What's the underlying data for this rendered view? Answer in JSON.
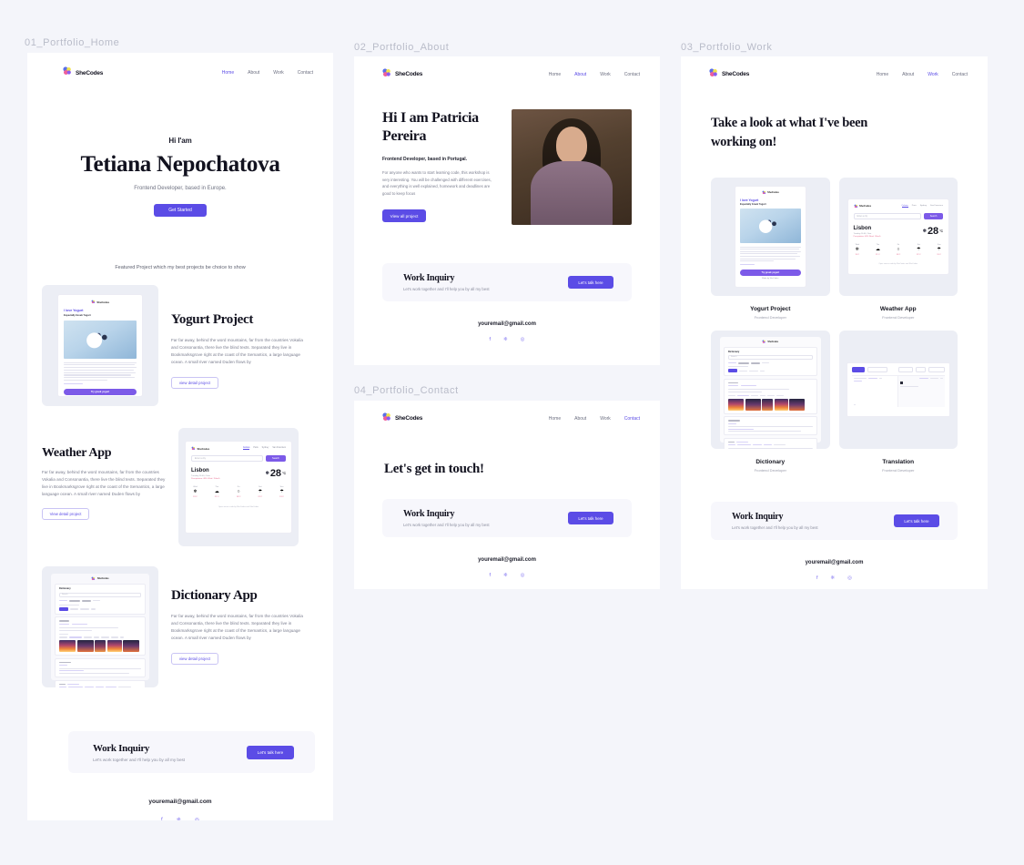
{
  "canvas": {
    "background": "#f4f5fa",
    "accent": "#5b4ce6",
    "ink": "#12121f",
    "muted": "#7b7e8f"
  },
  "brand": {
    "name": "SheCodes"
  },
  "frames": [
    {
      "id": "f1",
      "label": "01_Portfolio_Home"
    },
    {
      "id": "f2",
      "label": "02_Portfolio_About"
    },
    {
      "id": "f3",
      "label": "03_Portfolio_Work"
    },
    {
      "id": "f4",
      "label": "04_Portfolio_Contact"
    }
  ],
  "nav": {
    "items": [
      "Home",
      "About",
      "Work",
      "Contact"
    ],
    "active_home": "Home",
    "active_about": "About",
    "active_work": "Work",
    "active_contact": "Contact"
  },
  "home": {
    "eyebrow": "Hi I'am",
    "name": "Tetiana Nepochatova",
    "tagline": "Frontend Developer, based in Europe.",
    "cta": "Get Started",
    "featured_caption": "Featured Project which my best projects be choice to show",
    "projects": [
      {
        "title": "Yogurt Project",
        "body": "Far far away, behind the word mountains, far from the countries Vokalia and Consonantia, there live the blind texts. Separated they live in Bookmarksgrove right at the coast of the Semantics, a large language ocean. A small river named Duden flows by",
        "cta": "view detail project"
      },
      {
        "title": "Weather App",
        "body": "Far far away, behind the word mountains, far from the countries Vokalia and Consonantia, there live the blind texts. Separated they live in Bookmarksgrove right at the coast of the Semantics, a large language ocean. A small river named Duden flows by",
        "cta": "View detail project"
      },
      {
        "title": "Dictionary App",
        "body": "Far far away, behind the word mountains, far from the countries Vokalia and Consonantia, there live the blind texts. Separated they live in Bookmarksgrove right at the coast of the Semantics, a large language ocean. A small river named Duden flows by",
        "cta": "view detail project"
      }
    ]
  },
  "about": {
    "heading": "Hi I am Patricia Pereira",
    "subheading": "Frontend Developer, based in Portugal.",
    "body": "For anyone who wants to start learning code, this workshop is very interesting. You will be challenged with different exercises, and everything is well explained, homework and deadlines are good to keep focus",
    "cta": "View all project"
  },
  "work": {
    "heading": "Take a look at what I've been working on!",
    "cards": [
      {
        "title": "Yogurt Project",
        "role": "Frontend Developer"
      },
      {
        "title": "Weather App",
        "role": "Frontend Developer"
      },
      {
        "title": "Dictionary",
        "role": "Frontend Developer"
      },
      {
        "title": "Translation",
        "role": "Frontend Developer"
      }
    ]
  },
  "contact": {
    "heading": "Let's get in touch!"
  },
  "inquiry": {
    "title": "Work Inquiry",
    "subtitle": "Let's work  together and I'll help you by all my best",
    "cta": "Let's talk here"
  },
  "footer": {
    "email": "youremail@gmail.com",
    "socials": [
      "facebook-icon",
      "twitter-icon",
      "instagram-icon"
    ],
    "glyphs": {
      "facebook": "f",
      "twitter": "❈",
      "instagram": "◎"
    }
  },
  "mockups": {
    "yogurt": {
      "title": "I love Yogurt",
      "subtitle": "Especially Greek Yogurt",
      "cta": "Try greek yogurt",
      "footer": "Made by SheCodes"
    },
    "weather": {
      "search_placeholder": "Enter a city",
      "search_button": "Search",
      "city": "Lisbon",
      "datetime": "Tuesday 16:40, Clear",
      "precip": "Precipitation: 48%  Wind: 15km/h",
      "temperature": "28",
      "unit": "°C",
      "tabs": [
        "Celsius",
        "Paris",
        "Sydney",
        "San Francisco"
      ],
      "forecast": [
        {
          "day": "Wed",
          "temp": "19°C"
        },
        {
          "day": "Thu",
          "temp": "21°C"
        },
        {
          "day": "Fri",
          "temp": "18°C"
        },
        {
          "day": "Sat",
          "temp": "22°C"
        },
        {
          "day": "Sun",
          "temp": "19°C"
        }
      ],
      "footer": "Open source code by SheCodes and SheCodes"
    },
    "dictionary": {
      "title": "Dictionary",
      "search_placeholder": "Search"
    },
    "translation": {
      "title": "Translation"
    }
  }
}
